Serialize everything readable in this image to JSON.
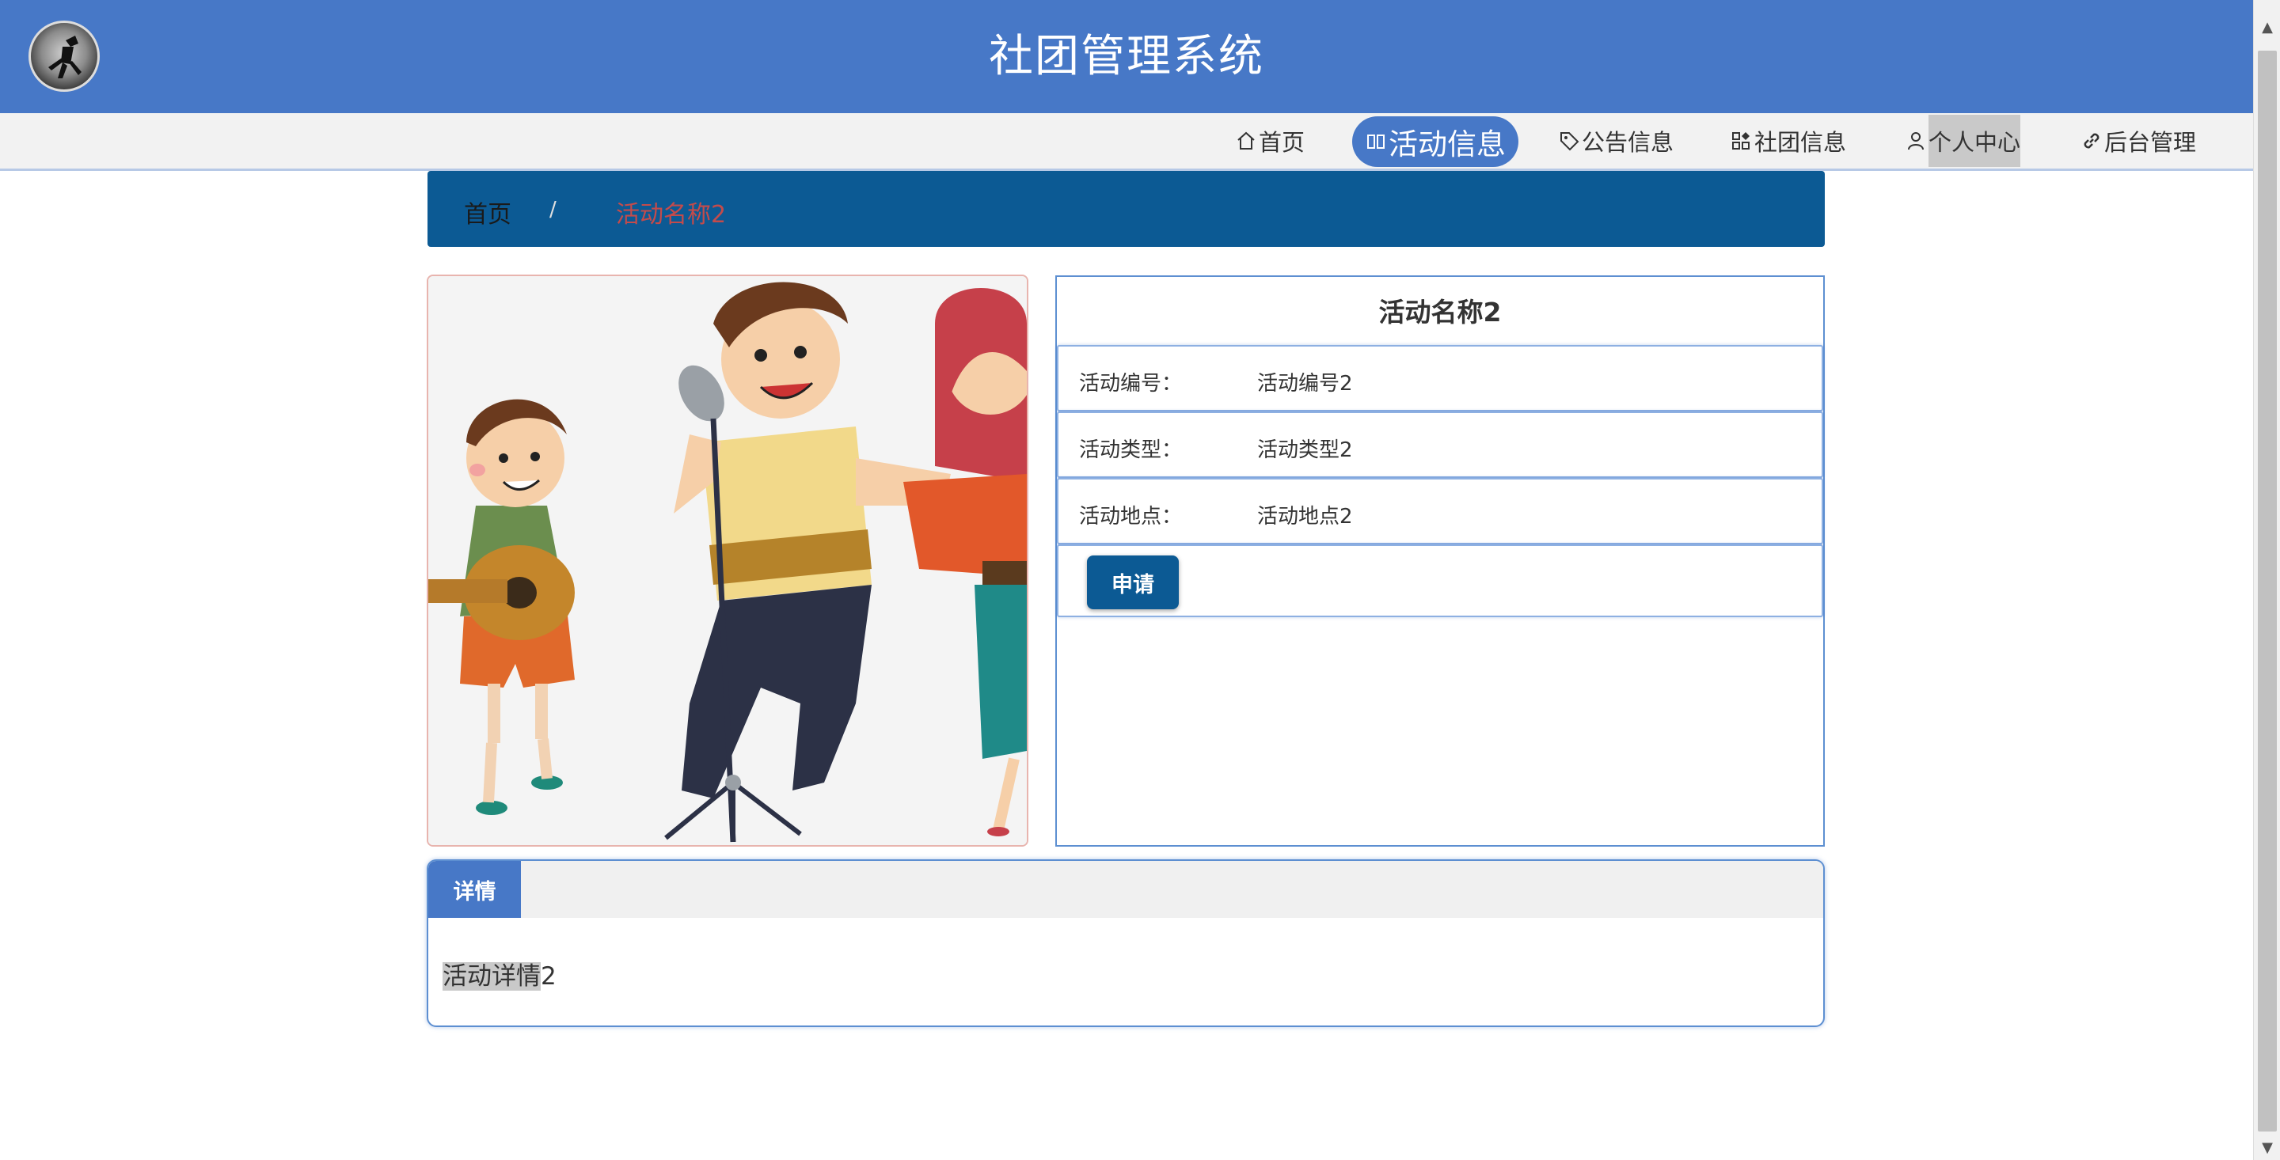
{
  "header": {
    "title": "社团管理系统"
  },
  "nav": {
    "items": [
      {
        "label": "首页",
        "icon": "home-icon"
      },
      {
        "label": "活动信息",
        "icon": "columns-icon",
        "active": true
      },
      {
        "label": "公告信息",
        "icon": "tag-icon"
      },
      {
        "label": "社团信息",
        "icon": "grid-icon"
      },
      {
        "label": "个人中心",
        "icon": "user-icon"
      },
      {
        "label": "后台管理",
        "icon": "link-icon"
      }
    ]
  },
  "breadcrumb": {
    "home": "首页",
    "separator": "/",
    "current": "活动名称2"
  },
  "activity": {
    "name": "活动名称2",
    "fields": [
      {
        "label": "活动编号：",
        "value": "活动编号2"
      },
      {
        "label": "活动类型：",
        "value": "活动类型2"
      },
      {
        "label": "活动地点：",
        "value": "活动地点2"
      }
    ],
    "apply_label": "申请"
  },
  "details": {
    "tab_label": "详情",
    "text_highlight": "活动详情",
    "text_rest": "2"
  },
  "colors": {
    "header_bg": "#4778c7",
    "breadcrumb_bg": "#0c5a94",
    "button_bg": "#0c5a94",
    "breadcrumb_current": "#c44b4b"
  }
}
